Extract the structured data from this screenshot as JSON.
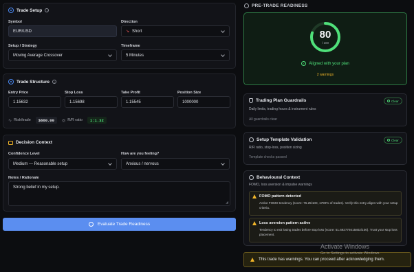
{
  "trade_setup": {
    "title": "Trade Setup",
    "symbol_label": "Symbol",
    "symbol_value": "EUR/USD",
    "direction_label": "Direction",
    "direction_value": "Short",
    "strategy_label": "Setup / Strategy",
    "strategy_value": "Moving Average Crossover",
    "timeframe_label": "Timeframe",
    "timeframe_value": "5 Minutes"
  },
  "trade_structure": {
    "title": "Trade Structure",
    "entry_label": "Entry Price",
    "entry_value": "1.15632",
    "stop_label": "Stop Loss",
    "stop_value": "1.15698",
    "tp_label": "Take Profit",
    "tp_value": "1.15545",
    "size_label": "Position Size",
    "size_value": "1000000",
    "risk_label": "Risk/trade",
    "risk_value": "$660.00",
    "rr_label": "R/R ratio",
    "rr_value": "1:1.32"
  },
  "decision_context": {
    "title": "Decision Context",
    "confidence_label": "Confidence Level",
    "confidence_value": "Medium — Reasonable setup",
    "feeling_label": "How are you feeling?",
    "feeling_value": "Anxious / nervous",
    "notes_label": "Notes / Rationale",
    "notes_value": "Strong belief in my setup."
  },
  "evaluate_button": "Evaluate Trade Readiness",
  "readiness": {
    "header": "PRE-TRADE READINESS",
    "score": "80",
    "score_max": "/ 100",
    "score_fraction": 0.8,
    "status": "Aligned with your plan",
    "warnings": "2 warnings"
  },
  "guardrails": {
    "title": "Trading Plan Guardrails",
    "subtitle": "Daily limits, trading hours & instrument rules",
    "note": "All guardrails clear",
    "badge": "Clear"
  },
  "template_validation": {
    "title": "Setup Template Validation",
    "subtitle": "R/R ratio, stop-loss, position sizing",
    "note": "Template checks passed",
    "badge": "Clear"
  },
  "behavioural": {
    "title": "Behavioural Context",
    "subtitle": "FOMO, loss aversion & impulse warnings",
    "fomo_title": "FOMO pattern detected",
    "fomo_text": "Active FOMO tendency (score: 76.25/100, 1790% of trades). Verify this entry aligns with your setup criteria.",
    "loss_title": "Loss aversion pattern active",
    "loss_text": "Tendency to exit losing trades before stop loss (score: 51.692779415802/100). Trust your stop loss placement."
  },
  "footer_warning": "This trade has warnings. You can proceed after acknowledging them.",
  "watermark": {
    "title": "Activate Windows",
    "subtitle": "Go to Settings to activate Windows."
  },
  "colors": {
    "accent": "#4b8bf5",
    "success": "#4fe07a",
    "warning": "#f0b429",
    "button": "#5b8ef0"
  }
}
